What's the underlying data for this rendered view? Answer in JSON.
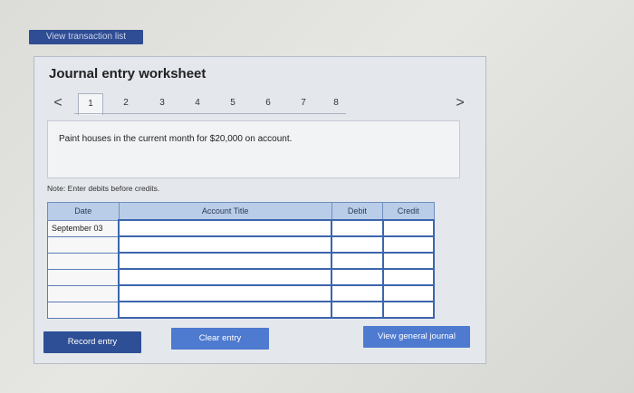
{
  "top_button": {
    "label": "View transaction list"
  },
  "worksheet": {
    "title": "Journal entry worksheet",
    "nav_prev": "<",
    "nav_next": ">",
    "tabs": [
      "1",
      "2",
      "3",
      "4",
      "5",
      "6",
      "7",
      "8"
    ],
    "active_tab": "1",
    "description": "Paint houses in the current month for $20,000 on account.",
    "note": "Note: Enter debits before credits.",
    "table": {
      "headers": {
        "date": "Date",
        "account": "Account Title",
        "debit": "Debit",
        "credit": "Credit"
      },
      "first_date": "September 03"
    }
  },
  "buttons": {
    "record": "Record entry",
    "clear": "Clear entry",
    "view_journal": "View general journal"
  }
}
